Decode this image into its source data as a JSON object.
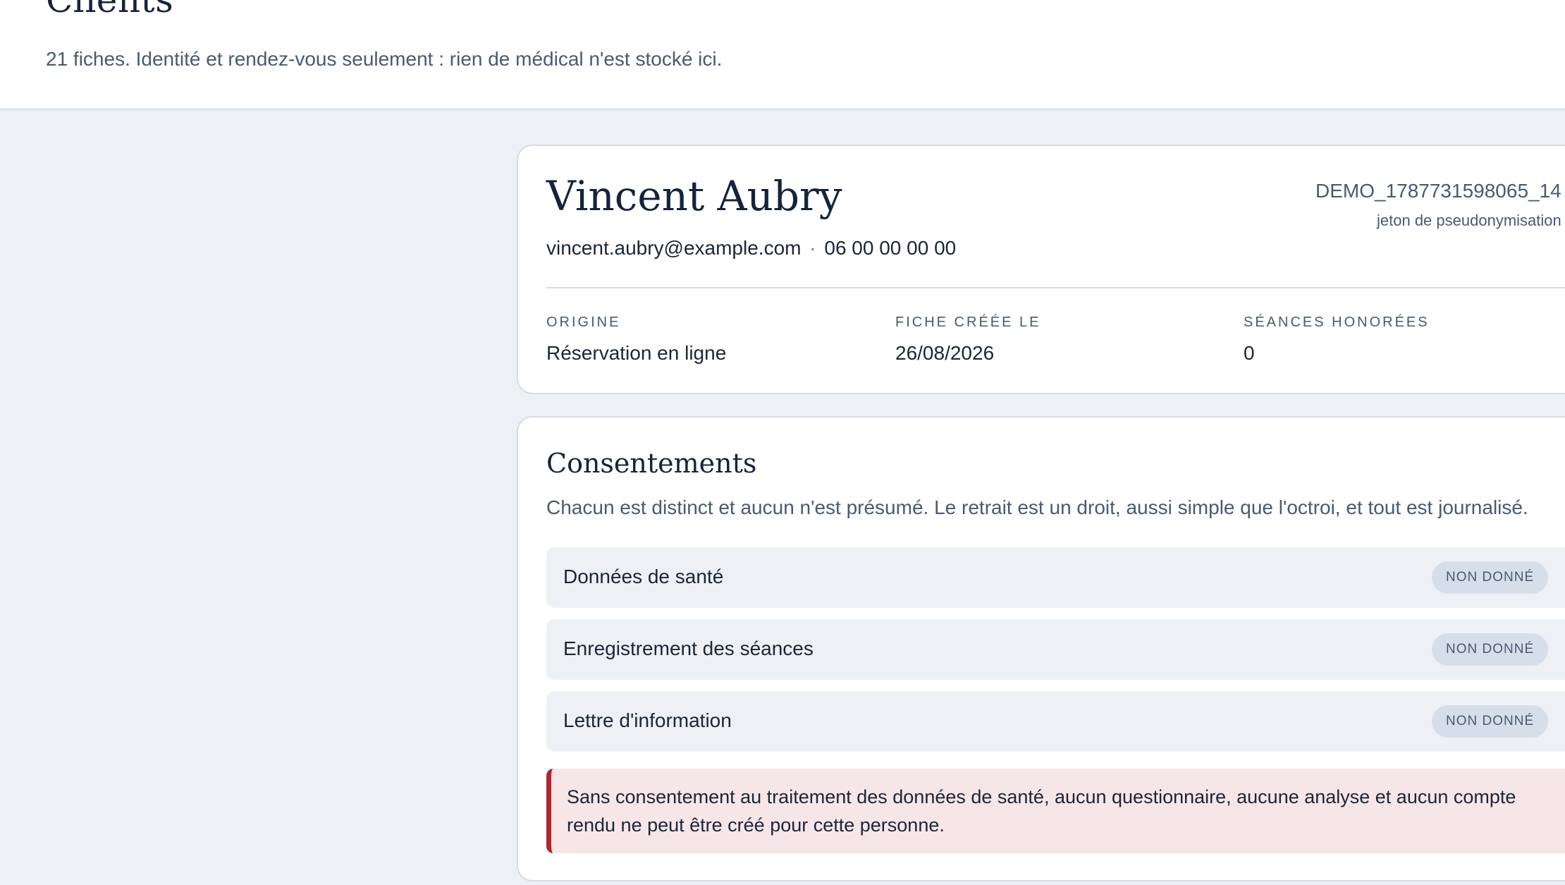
{
  "header": {
    "title": "Clients",
    "subtitle": "21 fiches. Identité et rendez-vous seulement : rien de médical n'est stocké ici."
  },
  "client": {
    "name": "Vincent Aubry",
    "email": "vincent.aubry@example.com",
    "separator": "·",
    "phone": "06 00 00 00 00",
    "token": "DEMO_1787731598065_14",
    "token_label": "jeton de pseudonymisation",
    "meta": [
      {
        "label": "ORIGINE",
        "value": "Réservation en ligne"
      },
      {
        "label": "FICHE CRÉÉE LE",
        "value": "26/08/2026"
      },
      {
        "label": "SÉANCES HONORÉES",
        "value": "0"
      }
    ]
  },
  "consents": {
    "title": "Consentements",
    "description": "Chacun est distinct et aucun n'est présumé. Le retrait est un droit, aussi simple que l'octroi, et tout est journalisé.",
    "items": [
      {
        "label": "Données de santé",
        "status": "NON DONNÉ"
      },
      {
        "label": "Enregistrement des séances",
        "status": "NON DONNÉ"
      },
      {
        "label": "Lettre d'information",
        "status": "NON DONNÉ"
      }
    ],
    "warning": "Sans consentement au traitement des données de santé, aucun questionnaire, aucune analyse et aucun compte rendu ne peut être créé pour cette personne."
  },
  "colors": {
    "background": "#edf1f5",
    "card": "#ffffff",
    "heading": "#16233a",
    "muted": "#4a5a70",
    "badge_bg": "#d6dfe9",
    "alert_bg": "#f7e6e8",
    "alert_accent": "#b3242c"
  }
}
